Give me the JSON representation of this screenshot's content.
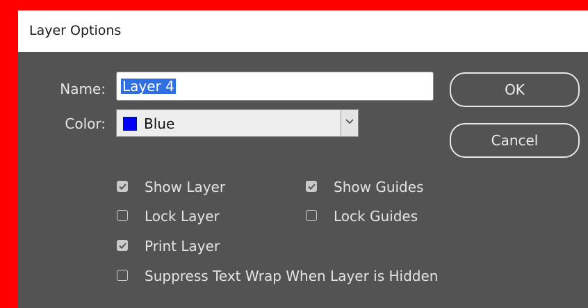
{
  "window": {
    "title": "Layer Options"
  },
  "fields": {
    "name_label": "Name:",
    "name_value": "Layer 4",
    "color_label": "Color:",
    "color_value": "Blue",
    "color_swatch": "#0000ff"
  },
  "buttons": {
    "ok": "OK",
    "cancel": "Cancel"
  },
  "checkboxes": {
    "show_layer": {
      "label": "Show Layer",
      "checked": true
    },
    "lock_layer": {
      "label": "Lock Layer",
      "checked": false
    },
    "print_layer": {
      "label": "Print Layer",
      "checked": true
    },
    "suppress_text_wrap": {
      "label": "Suppress Text Wrap When Layer is Hidden",
      "checked": false
    },
    "show_guides": {
      "label": "Show Guides",
      "checked": true
    },
    "lock_guides": {
      "label": "Lock Guides",
      "checked": false
    }
  },
  "icons": {
    "dropdown": "chevron-down-icon",
    "check": "checkmark-icon"
  },
  "colors": {
    "frame": "#ff0000",
    "dialog_bg": "#535353",
    "selection": "#2f6fe0"
  }
}
